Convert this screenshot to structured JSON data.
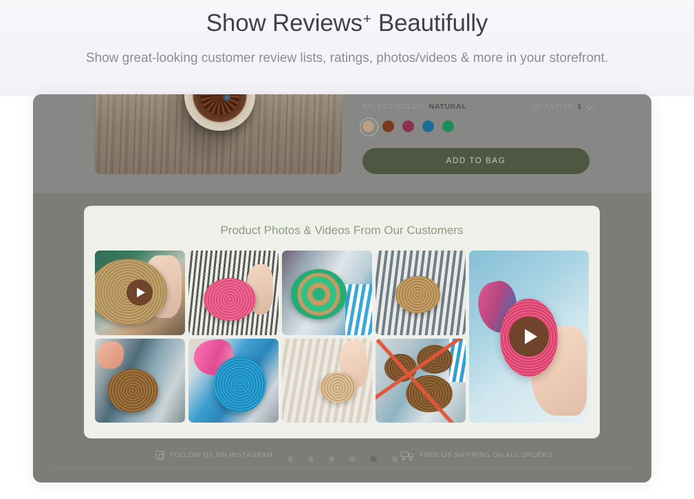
{
  "hero": {
    "title_main": "Show Reviews",
    "title_plus": "+",
    "title_tail": " Beautifully",
    "subtitle": "Show great-looking customer review lists, ratings, photos/videos & more in your storefront."
  },
  "product": {
    "select_color_label": "SELECT COLOR:",
    "selected_color": "NATURAL",
    "quantity_label": "QUANTITY:",
    "quantity_value": "1",
    "add_to_bag_label": "ADD TO BAG",
    "swatches": [
      {
        "name": "natural",
        "hex": "#b99e87",
        "selected": true
      },
      {
        "name": "brown",
        "hex": "#7c3a1c",
        "selected": false
      },
      {
        "name": "maroon",
        "hex": "#8e2f4e",
        "selected": false
      },
      {
        "name": "teal-blue",
        "hex": "#1b6d91",
        "selected": false
      },
      {
        "name": "green",
        "hex": "#1f8a5c",
        "selected": false
      }
    ]
  },
  "ugc": {
    "title": "Product Photos & Videos From Our Customers",
    "tiles": [
      {
        "id": "tile-1",
        "style": "t1",
        "video": true,
        "big": false
      },
      {
        "id": "tile-2",
        "style": "t2",
        "video": false,
        "big": false
      },
      {
        "id": "tile-3",
        "style": "t3",
        "video": false,
        "big": false
      },
      {
        "id": "tile-4",
        "style": "t4",
        "video": false,
        "big": false
      },
      {
        "id": "tile-5",
        "style": "t5",
        "video": true,
        "big": true
      },
      {
        "id": "tile-6",
        "style": "t6",
        "video": false,
        "big": false
      },
      {
        "id": "tile-7",
        "style": "t7",
        "video": false,
        "big": false
      },
      {
        "id": "tile-8",
        "style": "t8",
        "video": false,
        "big": false
      },
      {
        "id": "tile-9",
        "style": "t9",
        "video": false,
        "big": false
      }
    ]
  },
  "footer": {
    "instagram_text": "FOLLOW US ON INSTAGRAM",
    "shipping_text": "FREE US SHIPPING ON ALL ORDERS",
    "carousel_dots": 6,
    "carousel_active_index": 4
  },
  "colors": {
    "page_background": "#f6f6f9",
    "frame_top": "#878786",
    "frame_bottom": "#7c7c78",
    "card_background": "#f0f0ea",
    "accent_green": "#8b9b7f",
    "cta_green": "#4e5742",
    "play_brown": "#6f442b"
  }
}
